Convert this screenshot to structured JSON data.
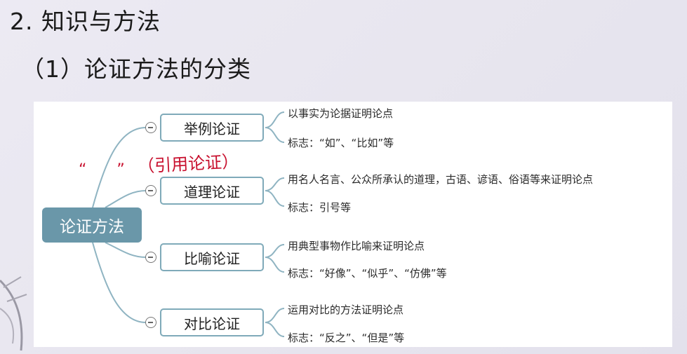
{
  "slide": {
    "title": "2. 知识与方法",
    "subtitle": "（1）论证方法的分类"
  },
  "mindmap": {
    "root": "论证方法",
    "branches": [
      {
        "label": "举例论证",
        "details": [
          "以事实为论据证明论点",
          "标志：“如”、“比如”等"
        ]
      },
      {
        "label": "道理论证",
        "details": [
          "用名人名言、公众所承认的道理，古语、谚语、俗语等来证明论点",
          "标志：引号等"
        ]
      },
      {
        "label": "比喻论证",
        "details": [
          "用典型事物作比喻来证明论点",
          "标志：“好像”、“似乎”、“仿佛”等"
        ]
      },
      {
        "label": "对比论证",
        "details": [
          "运用对比的方法证明论点",
          "标志：“反之”、“但是”等"
        ]
      }
    ]
  },
  "annotation": {
    "marks": "“ ”",
    "text": "（引用论证）",
    "color": "#c8102e"
  },
  "colors": {
    "root_fill": "#6a97a9",
    "branch_border": "#7faab9",
    "connector": "#8fb4c2"
  }
}
